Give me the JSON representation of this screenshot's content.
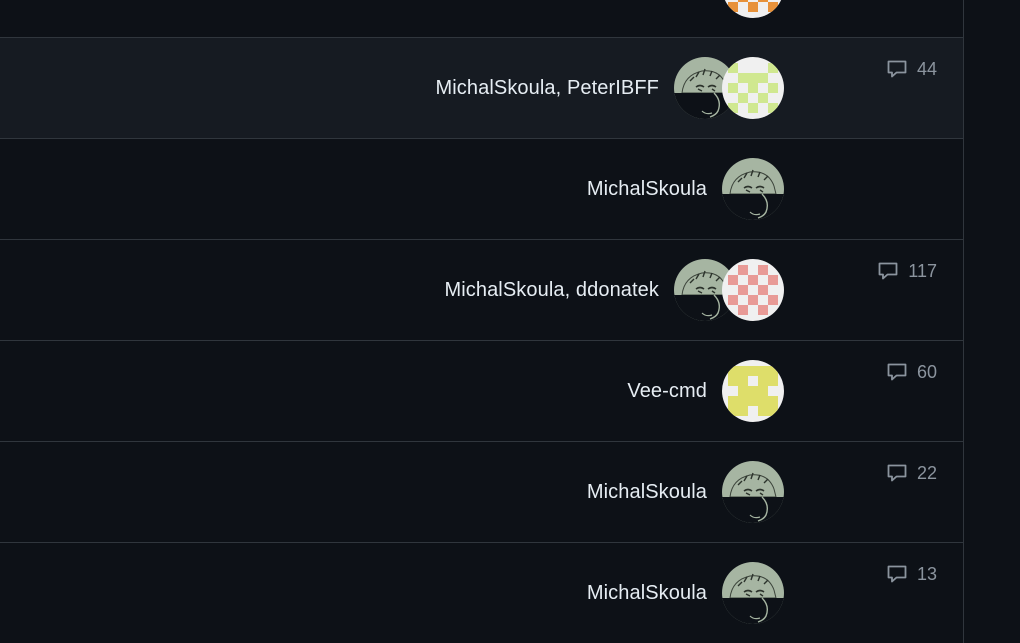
{
  "issues": [
    {
      "assignees_text": "",
      "avatars": [
        "identicon-orange"
      ],
      "comments": "",
      "hovered": false
    },
    {
      "assignees_text": "MichalSkoula, PeterIBFF",
      "avatars": [
        "sketch-face",
        "identicon-lime"
      ],
      "comments": "44",
      "hovered": true
    },
    {
      "assignees_text": "MichalSkoula",
      "avatars": [
        "sketch-face"
      ],
      "comments": "",
      "hovered": false
    },
    {
      "assignees_text": "MichalSkoula, ddonatek",
      "avatars": [
        "sketch-face",
        "identicon-pink"
      ],
      "comments": "117",
      "hovered": false
    },
    {
      "assignees_text": "Vee-cmd",
      "avatars": [
        "identicon-yellow"
      ],
      "comments": "60",
      "hovered": false
    },
    {
      "assignees_text": "MichalSkoula",
      "avatars": [
        "sketch-face"
      ],
      "comments": "22",
      "hovered": false
    },
    {
      "assignees_text": "MichalSkoula",
      "avatars": [
        "sketch-face"
      ],
      "comments": "13",
      "hovered": false
    }
  ],
  "icons": {
    "comment": "comment-icon"
  },
  "colors": {
    "background": "#0d1117",
    "row_hover": "#161b22",
    "border": "#30363d",
    "text": "#e6edf3",
    "muted": "#8b949e",
    "sketch_avatar_bg": "#a6b5a2",
    "identicon_orange": "#e8923a",
    "identicon_lime": "#d0e890",
    "identicon_pink": "#e89a96",
    "identicon_yellow": "#dede6a"
  }
}
